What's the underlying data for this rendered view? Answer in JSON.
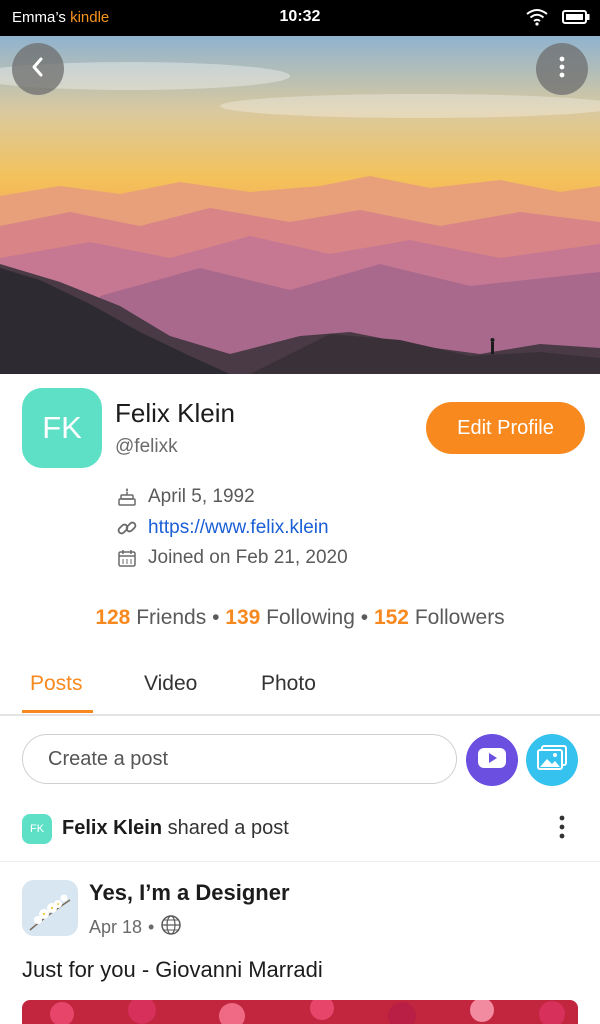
{
  "status_bar": {
    "owner": "Emma’s",
    "brand": "kindle",
    "time": "10:32"
  },
  "profile": {
    "initials": "FK",
    "name": "Felix Klein",
    "handle": "@felixk",
    "edit_button": "Edit Profile",
    "birthday": "April 5, 1992",
    "website": "https://www.felix.klein",
    "joined": "Joined on Feb 21, 2020"
  },
  "stats": {
    "friends_count": "128",
    "friends_label": "Friends",
    "following_count": "139",
    "following_label": "Following",
    "followers_count": "152",
    "followers_label": "Followers",
    "separator": "•"
  },
  "tabs": [
    {
      "label": "Posts",
      "active": true
    },
    {
      "label": "Video",
      "active": false
    },
    {
      "label": "Photo",
      "active": false
    }
  ],
  "composer": {
    "placeholder": "Create a post"
  },
  "feed": {
    "share_initials": "FK",
    "share_name": "Felix Klein",
    "share_action": "shared a post",
    "post_title": "Yes, I’m a Designer",
    "post_date": "Apr 18",
    "post_separator": "•",
    "post_body": "Just for you - Giovanni Marradi"
  },
  "colors": {
    "accent": "#f7891f",
    "avatar": "#5ee0c7",
    "link": "#1a5fd6",
    "video_button": "#6a4fe0",
    "photo_button": "#35c2ee"
  },
  "icons": {
    "back": "chevron-left-icon",
    "more": "more-vertical-icon",
    "birthday": "cake-icon",
    "website": "link-icon",
    "joined": "calendar-icon",
    "video": "play-icon",
    "photo": "image-icon",
    "visibility": "globe-icon",
    "wifi": "wifi-icon",
    "battery": "battery-icon"
  }
}
